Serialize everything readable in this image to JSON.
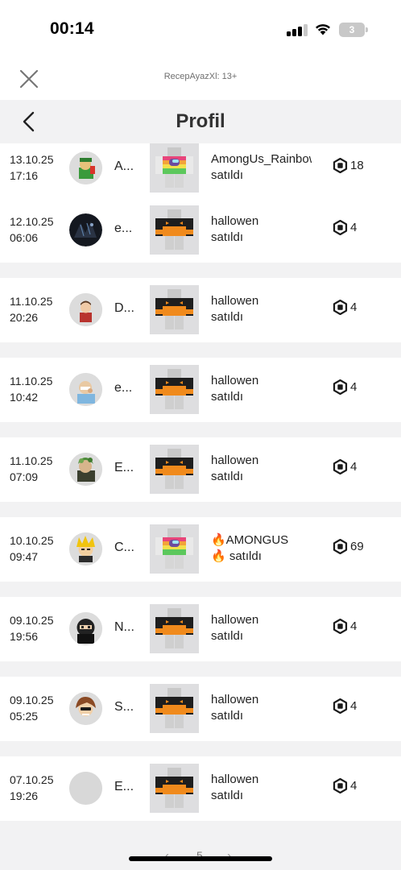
{
  "status_bar": {
    "time": "00:14",
    "battery": "3"
  },
  "top_bar": {
    "site_label": "RecepAyazXl: 13+"
  },
  "header": {
    "title": "Profil"
  },
  "rows": [
    {
      "date": "13.10.25",
      "time": "17:16",
      "user": "A...",
      "item": "AmongUs_Rainbow",
      "status": "satıldı",
      "price": "18",
      "avatar": "avatar-green",
      "thumb": "amongus-shirt"
    },
    {
      "date": "12.10.25",
      "time": "06:06",
      "user": "e...",
      "item": "hallowen",
      "status": "satıldı",
      "price": "4",
      "avatar": "avatar-dark",
      "thumb": "hallowen-shirt"
    },
    {
      "date": "11.10.25",
      "time": "20:26",
      "user": "D...",
      "item": "hallowen",
      "status": "satıldı",
      "price": "4",
      "avatar": "avatar-red",
      "thumb": "hallowen-shirt"
    },
    {
      "date": "11.10.25",
      "time": "10:42",
      "user": "e...",
      "item": "hallowen",
      "status": "satıldı",
      "price": "4",
      "avatar": "avatar-blue",
      "thumb": "hallowen-shirt"
    },
    {
      "date": "11.10.25",
      "time": "07:09",
      "user": "E...",
      "item": "hallowen",
      "status": "satıldı",
      "price": "4",
      "avatar": "avatar-camo",
      "thumb": "hallowen-shirt"
    },
    {
      "date": "10.10.25",
      "time": "09:47",
      "user": "C...",
      "item": "🔥AMONGUS",
      "status": "🔥 satıldı",
      "price": "69",
      "avatar": "avatar-yellow",
      "thumb": "amongus-shirt"
    },
    {
      "date": "09.10.25",
      "time": "19:56",
      "user": "N...",
      "item": "hallowen",
      "status": "satıldı",
      "price": "4",
      "avatar": "avatar-black",
      "thumb": "hallowen-shirt"
    },
    {
      "date": "09.10.25",
      "time": "05:25",
      "user": "S...",
      "item": "hallowen",
      "status": "satıldı",
      "price": "4",
      "avatar": "avatar-brown",
      "thumb": "hallowen-shirt"
    },
    {
      "date": "07.10.25",
      "time": "19:26",
      "user": "E...",
      "item": "hallowen",
      "status": "satıldı",
      "price": "4",
      "avatar": "avatar-empty",
      "thumb": "hallowen-shirt"
    }
  ],
  "pager": {
    "page": "5"
  },
  "colors": {
    "background": "#f2f2f3",
    "row": "#ffffff",
    "text": "#222222",
    "thumb_bg": "#dedee0",
    "pumpkin": "#f08a1c"
  }
}
